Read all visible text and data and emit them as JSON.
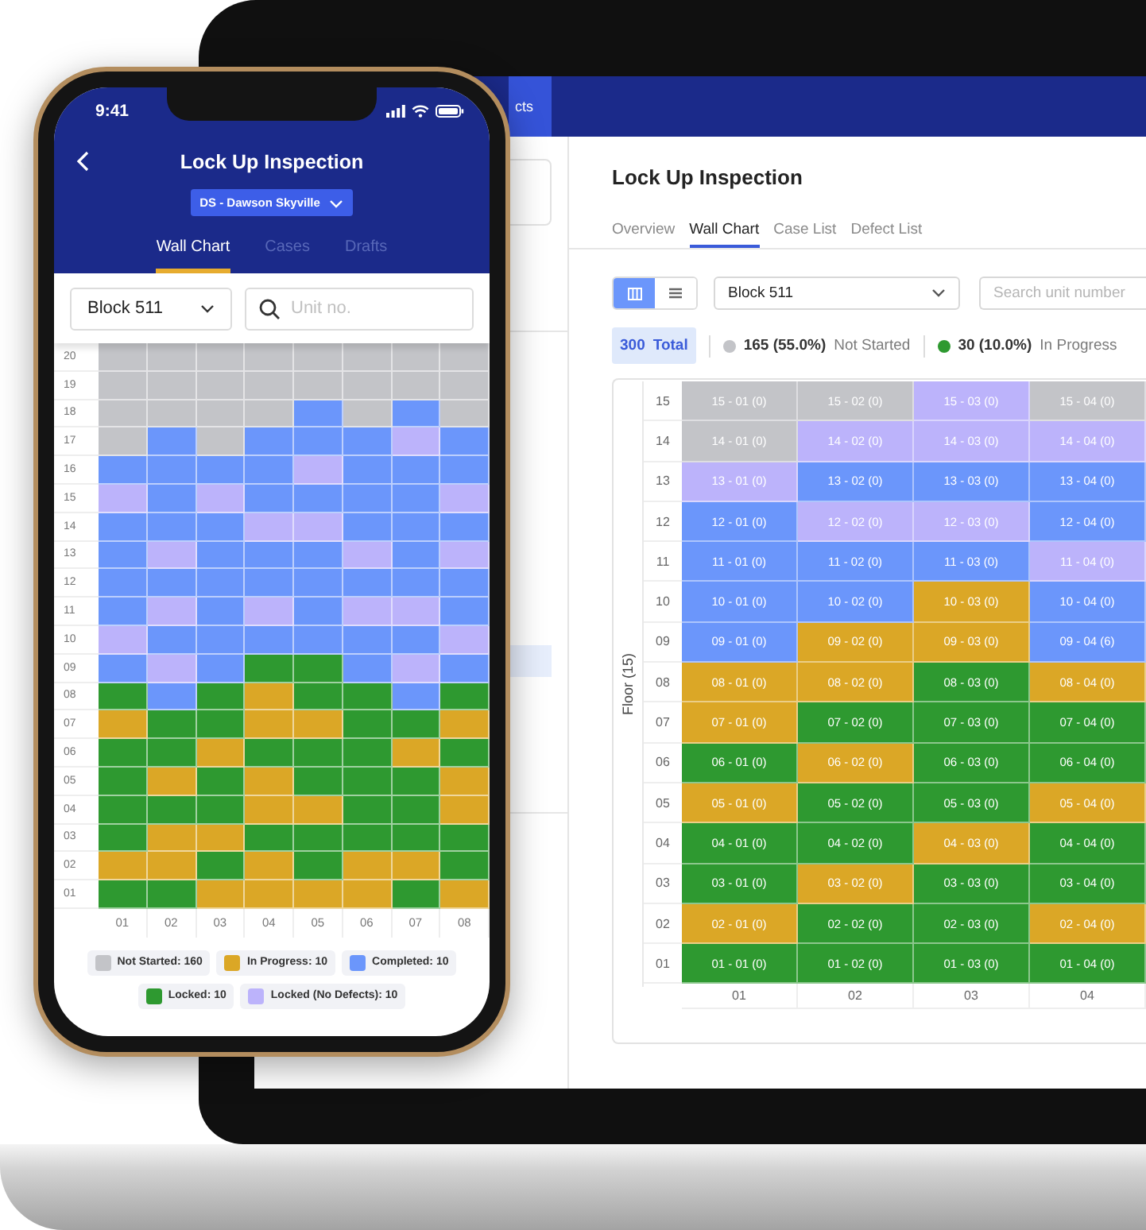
{
  "laptop": {
    "nav_tab": "cts",
    "page_title": "Lock Up Inspection",
    "tabs": [
      {
        "label": "Overview",
        "selected": false
      },
      {
        "label": "Wall Chart",
        "selected": true
      },
      {
        "label": "Case List",
        "selected": false
      },
      {
        "label": "Defect List",
        "selected": false
      }
    ],
    "view_toggle": [
      {
        "kind": "grid",
        "selected": true
      },
      {
        "kind": "list",
        "selected": false
      }
    ],
    "block_select": {
      "value": "Block 511"
    },
    "search": {
      "placeholder": "Search unit number"
    },
    "total": {
      "count": "300",
      "label": "Total"
    },
    "stats": [
      {
        "value": "165 (55.0%)",
        "label": "Not Started",
        "color": "#c3c4c8"
      },
      {
        "value": "30 (10.0%)",
        "label": "In Progress",
        "color": "#2e9930"
      }
    ],
    "wall_chart": {
      "axis_label": "Floor (15)",
      "columns": [
        "01",
        "02",
        "03",
        "04"
      ],
      "rows": [
        {
          "floor": "15",
          "units": [
            {
              "label": "15 - 01 (0)",
              "color": "#c3c4c8"
            },
            {
              "label": "15 - 02 (0)",
              "color": "#c3c4c8"
            },
            {
              "label": "15 - 03 (0)",
              "color": "#bcb3fb"
            },
            {
              "label": "15 - 04 (0)",
              "color": "#c3c4c8"
            }
          ]
        },
        {
          "floor": "14",
          "units": [
            {
              "label": "14 - 01 (0)",
              "color": "#c3c4c8"
            },
            {
              "label": "14 - 02 (0)",
              "color": "#bcb3fb"
            },
            {
              "label": "14 - 03 (0)",
              "color": "#bcb3fb"
            },
            {
              "label": "14 - 04 (0)",
              "color": "#bcb3fb"
            }
          ]
        },
        {
          "floor": "13",
          "units": [
            {
              "label": "13 - 01 (0)",
              "color": "#bcb3fb"
            },
            {
              "label": "13 - 02 (0)",
              "color": "#6b96fb"
            },
            {
              "label": "13 - 03 (0)",
              "color": "#6b96fb"
            },
            {
              "label": "13 - 04 (0)",
              "color": "#6b96fb"
            }
          ]
        },
        {
          "floor": "12",
          "units": [
            {
              "label": "12 - 01 (0)",
              "color": "#6b96fb"
            },
            {
              "label": "12 - 02 (0)",
              "color": "#bcb3fb"
            },
            {
              "label": "12 - 03 (0)",
              "color": "#bcb3fb"
            },
            {
              "label": "12 - 04 (0)",
              "color": "#6b96fb"
            }
          ]
        },
        {
          "floor": "11",
          "units": [
            {
              "label": "11 - 01 (0)",
              "color": "#6b96fb"
            },
            {
              "label": "11 - 02 (0)",
              "color": "#6b96fb"
            },
            {
              "label": "11 - 03 (0)",
              "color": "#6b96fb"
            },
            {
              "label": "11 - 04 (0)",
              "color": "#bcb3fb"
            }
          ]
        },
        {
          "floor": "10",
          "units": [
            {
              "label": "10 - 01 (0)",
              "color": "#6b96fb"
            },
            {
              "label": "10 - 02 (0)",
              "color": "#6b96fb"
            },
            {
              "label": "10 - 03 (0)",
              "color": "#dba726"
            },
            {
              "label": "10 - 04 (0)",
              "color": "#6b96fb"
            }
          ]
        },
        {
          "floor": "09",
          "units": [
            {
              "label": "09 - 01 (0)",
              "color": "#6b96fb"
            },
            {
              "label": "09 - 02 (0)",
              "color": "#dba726"
            },
            {
              "label": "09 - 03 (0)",
              "color": "#dba726"
            },
            {
              "label": "09 - 04 (6)",
              "color": "#6b96fb"
            }
          ]
        },
        {
          "floor": "08",
          "units": [
            {
              "label": "08 - 01 (0)",
              "color": "#dba726"
            },
            {
              "label": "08 - 02 (0)",
              "color": "#dba726"
            },
            {
              "label": "08 - 03 (0)",
              "color": "#2e9930"
            },
            {
              "label": "08 - 04 (0)",
              "color": "#dba726"
            }
          ]
        },
        {
          "floor": "07",
          "units": [
            {
              "label": "07 - 01 (0)",
              "color": "#dba726"
            },
            {
              "label": "07 - 02 (0)",
              "color": "#2e9930"
            },
            {
              "label": "07 - 03 (0)",
              "color": "#2e9930"
            },
            {
              "label": "07 - 04 (0)",
              "color": "#2e9930"
            }
          ]
        },
        {
          "floor": "06",
          "units": [
            {
              "label": "06 - 01 (0)",
              "color": "#2e9930"
            },
            {
              "label": "06 - 02 (0)",
              "color": "#dba726"
            },
            {
              "label": "06 - 03 (0)",
              "color": "#2e9930"
            },
            {
              "label": "06 - 04 (0)",
              "color": "#2e9930"
            }
          ]
        },
        {
          "floor": "05",
          "units": [
            {
              "label": "05 - 01 (0)",
              "color": "#dba726"
            },
            {
              "label": "05 - 02 (0)",
              "color": "#2e9930"
            },
            {
              "label": "05 - 03 (0)",
              "color": "#2e9930"
            },
            {
              "label": "05 - 04 (0)",
              "color": "#dba726"
            }
          ]
        },
        {
          "floor": "04",
          "units": [
            {
              "label": "04 - 01 (0)",
              "color": "#2e9930"
            },
            {
              "label": "04 - 02 (0)",
              "color": "#2e9930"
            },
            {
              "label": "04 - 03 (0)",
              "color": "#dba726"
            },
            {
              "label": "04 - 04 (0)",
              "color": "#2e9930"
            }
          ]
        },
        {
          "floor": "03",
          "units": [
            {
              "label": "03 - 01 (0)",
              "color": "#2e9930"
            },
            {
              "label": "03 - 02 (0)",
              "color": "#dba726"
            },
            {
              "label": "03 - 03 (0)",
              "color": "#2e9930"
            },
            {
              "label": "03 - 04 (0)",
              "color": "#2e9930"
            }
          ]
        },
        {
          "floor": "02",
          "units": [
            {
              "label": "02 - 01 (0)",
              "color": "#dba726"
            },
            {
              "label": "02 - 02 (0)",
              "color": "#2e9930"
            },
            {
              "label": "02 - 03 (0)",
              "color": "#2e9930"
            },
            {
              "label": "02 - 04 (0)",
              "color": "#dba726"
            }
          ]
        },
        {
          "floor": "01",
          "units": [
            {
              "label": "01 - 01 (0)",
              "color": "#2e9930"
            },
            {
              "label": "01 - 02 (0)",
              "color": "#2e9930"
            },
            {
              "label": "01 - 03 (0)",
              "color": "#2e9930"
            },
            {
              "label": "01 - 04 (0)",
              "color": "#2e9930"
            }
          ]
        }
      ]
    }
  },
  "phone": {
    "time": "9:41",
    "title": "Lock Up Inspection",
    "project": "DS - Dawson Skyville",
    "tabs": [
      {
        "label": "Wall Chart",
        "selected": true
      },
      {
        "label": "Cases",
        "selected": false
      },
      {
        "label": "Drafts",
        "selected": false
      }
    ],
    "block_select": {
      "value": "Block 511"
    },
    "search": {
      "placeholder": "Unit no."
    },
    "wall_chart": {
      "columns": [
        "01",
        "02",
        "03",
        "04",
        "05",
        "06",
        "07",
        "08"
      ],
      "rows": [
        {
          "floor": "20",
          "cells": [
            {
              "color": "#c3c4c8"
            },
            {
              "color": "#c3c4c8"
            },
            {
              "color": "#c3c4c8"
            },
            {
              "color": "#c3c4c8"
            },
            {
              "color": "#c3c4c8"
            },
            {
              "color": "#c3c4c8"
            },
            {
              "color": "#c3c4c8"
            },
            {
              "color": "#c3c4c8"
            }
          ]
        },
        {
          "floor": "19",
          "cells": [
            {
              "color": "#c3c4c8"
            },
            {
              "color": "#c3c4c8"
            },
            {
              "color": "#c3c4c8"
            },
            {
              "color": "#c3c4c8"
            },
            {
              "color": "#c3c4c8"
            },
            {
              "color": "#c3c4c8"
            },
            {
              "color": "#c3c4c8"
            },
            {
              "color": "#c3c4c8"
            }
          ]
        },
        {
          "floor": "18",
          "cells": [
            {
              "color": "#c3c4c8"
            },
            {
              "color": "#c3c4c8"
            },
            {
              "color": "#c3c4c8"
            },
            {
              "color": "#c3c4c8"
            },
            {
              "color": "#6b96fb"
            },
            {
              "color": "#c3c4c8"
            },
            {
              "color": "#6b96fb"
            },
            {
              "color": "#c3c4c8"
            }
          ]
        },
        {
          "floor": "17",
          "cells": [
            {
              "color": "#c3c4c8"
            },
            {
              "color": "#6b96fb"
            },
            {
              "color": "#c3c4c8"
            },
            {
              "color": "#6b96fb"
            },
            {
              "color": "#6b96fb"
            },
            {
              "color": "#6b96fb"
            },
            {
              "color": "#bcb3fb"
            },
            {
              "color": "#6b96fb"
            }
          ]
        },
        {
          "floor": "16",
          "cells": [
            {
              "color": "#6b96fb"
            },
            {
              "color": "#6b96fb"
            },
            {
              "color": "#6b96fb"
            },
            {
              "color": "#6b96fb"
            },
            {
              "color": "#bcb3fb"
            },
            {
              "color": "#6b96fb"
            },
            {
              "color": "#6b96fb"
            },
            {
              "color": "#6b96fb"
            }
          ]
        },
        {
          "floor": "15",
          "cells": [
            {
              "color": "#bcb3fb"
            },
            {
              "color": "#6b96fb"
            },
            {
              "color": "#bcb3fb"
            },
            {
              "color": "#6b96fb"
            },
            {
              "color": "#6b96fb"
            },
            {
              "color": "#6b96fb"
            },
            {
              "color": "#6b96fb"
            },
            {
              "color": "#bcb3fb"
            }
          ]
        },
        {
          "floor": "14",
          "cells": [
            {
              "color": "#6b96fb"
            },
            {
              "color": "#6b96fb"
            },
            {
              "color": "#6b96fb"
            },
            {
              "color": "#bcb3fb"
            },
            {
              "color": "#bcb3fb"
            },
            {
              "color": "#6b96fb"
            },
            {
              "color": "#6b96fb"
            },
            {
              "color": "#6b96fb"
            }
          ]
        },
        {
          "floor": "13",
          "cells": [
            {
              "color": "#6b96fb"
            },
            {
              "color": "#bcb3fb"
            },
            {
              "color": "#6b96fb"
            },
            {
              "color": "#6b96fb"
            },
            {
              "color": "#6b96fb"
            },
            {
              "color": "#bcb3fb"
            },
            {
              "color": "#6b96fb"
            },
            {
              "color": "#bcb3fb"
            }
          ]
        },
        {
          "floor": "12",
          "cells": [
            {
              "color": "#6b96fb"
            },
            {
              "color": "#6b96fb"
            },
            {
              "color": "#6b96fb"
            },
            {
              "color": "#6b96fb"
            },
            {
              "color": "#6b96fb"
            },
            {
              "color": "#6b96fb"
            },
            {
              "color": "#6b96fb"
            },
            {
              "color": "#6b96fb"
            }
          ]
        },
        {
          "floor": "11",
          "cells": [
            {
              "color": "#6b96fb"
            },
            {
              "color": "#bcb3fb"
            },
            {
              "color": "#6b96fb"
            },
            {
              "color": "#bcb3fb"
            },
            {
              "color": "#6b96fb"
            },
            {
              "color": "#bcb3fb"
            },
            {
              "color": "#bcb3fb"
            },
            {
              "color": "#6b96fb"
            }
          ]
        },
        {
          "floor": "10",
          "cells": [
            {
              "color": "#bcb3fb"
            },
            {
              "color": "#6b96fb"
            },
            {
              "color": "#6b96fb"
            },
            {
              "color": "#6b96fb"
            },
            {
              "color": "#6b96fb"
            },
            {
              "color": "#6b96fb"
            },
            {
              "color": "#6b96fb"
            },
            {
              "color": "#bcb3fb"
            }
          ]
        },
        {
          "floor": "09",
          "cells": [
            {
              "color": "#6b96fb"
            },
            {
              "color": "#bcb3fb"
            },
            {
              "color": "#6b96fb"
            },
            {
              "color": "#2e9930"
            },
            {
              "color": "#2e9930"
            },
            {
              "color": "#6b96fb"
            },
            {
              "color": "#bcb3fb"
            },
            {
              "color": "#6b96fb"
            }
          ]
        },
        {
          "floor": "08",
          "cells": [
            {
              "color": "#2e9930"
            },
            {
              "color": "#6b96fb"
            },
            {
              "color": "#2e9930"
            },
            {
              "color": "#dba726"
            },
            {
              "color": "#2e9930"
            },
            {
              "color": "#2e9930"
            },
            {
              "color": "#6b96fb"
            },
            {
              "color": "#2e9930"
            }
          ]
        },
        {
          "floor": "07",
          "cells": [
            {
              "color": "#dba726"
            },
            {
              "color": "#2e9930"
            },
            {
              "color": "#2e9930"
            },
            {
              "color": "#dba726"
            },
            {
              "color": "#dba726"
            },
            {
              "color": "#2e9930"
            },
            {
              "color": "#2e9930"
            },
            {
              "color": "#dba726"
            }
          ]
        },
        {
          "floor": "06",
          "cells": [
            {
              "color": "#2e9930"
            },
            {
              "color": "#2e9930"
            },
            {
              "color": "#dba726"
            },
            {
              "color": "#2e9930"
            },
            {
              "color": "#2e9930"
            },
            {
              "color": "#2e9930"
            },
            {
              "color": "#dba726"
            },
            {
              "color": "#2e9930"
            }
          ]
        },
        {
          "floor": "05",
          "cells": [
            {
              "color": "#2e9930"
            },
            {
              "color": "#dba726"
            },
            {
              "color": "#2e9930"
            },
            {
              "color": "#dba726"
            },
            {
              "color": "#2e9930"
            },
            {
              "color": "#2e9930"
            },
            {
              "color": "#2e9930"
            },
            {
              "color": "#dba726"
            }
          ]
        },
        {
          "floor": "04",
          "cells": [
            {
              "color": "#2e9930"
            },
            {
              "color": "#2e9930"
            },
            {
              "color": "#2e9930"
            },
            {
              "color": "#dba726"
            },
            {
              "color": "#dba726"
            },
            {
              "color": "#2e9930"
            },
            {
              "color": "#2e9930"
            },
            {
              "color": "#dba726"
            }
          ]
        },
        {
          "floor": "03",
          "cells": [
            {
              "color": "#2e9930"
            },
            {
              "color": "#dba726"
            },
            {
              "color": "#dba726"
            },
            {
              "color": "#2e9930"
            },
            {
              "color": "#2e9930"
            },
            {
              "color": "#2e9930"
            },
            {
              "color": "#2e9930"
            },
            {
              "color": "#2e9930"
            }
          ]
        },
        {
          "floor": "02",
          "cells": [
            {
              "color": "#dba726"
            },
            {
              "color": "#dba726"
            },
            {
              "color": "#2e9930"
            },
            {
              "color": "#dba726"
            },
            {
              "color": "#2e9930"
            },
            {
              "color": "#dba726"
            },
            {
              "color": "#dba726"
            },
            {
              "color": "#2e9930"
            }
          ]
        },
        {
          "floor": "01",
          "cells": [
            {
              "color": "#2e9930"
            },
            {
              "color": "#2e9930"
            },
            {
              "color": "#dba726"
            },
            {
              "color": "#dba726"
            },
            {
              "color": "#dba726"
            },
            {
              "color": "#dba726"
            },
            {
              "color": "#2e9930"
            },
            {
              "color": "#dba726"
            }
          ]
        }
      ]
    },
    "legend": [
      {
        "label": "Not Started: 160",
        "color": "#c3c4c8"
      },
      {
        "label": "In Progress: 10",
        "color": "#dba726"
      },
      {
        "label": "Completed: 10",
        "color": "#6b96fb"
      },
      {
        "label": "Locked: 10",
        "color": "#2e9930"
      },
      {
        "label": "Locked (No Defects): 10",
        "color": "#bcb3fb"
      }
    ]
  }
}
